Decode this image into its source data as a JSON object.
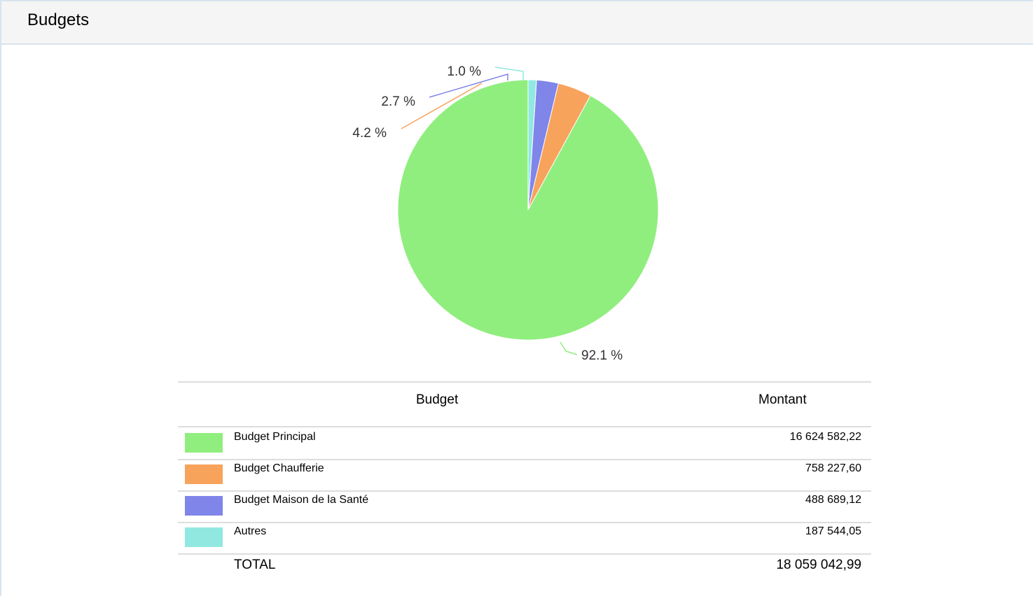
{
  "header": {
    "title": "Budgets"
  },
  "chart_data": {
    "type": "pie",
    "title": "",
    "slices": [
      {
        "label": "Budget Principal",
        "value": 16624582.22,
        "percent_label": "92.1 %",
        "color": "#90ee7e"
      },
      {
        "label": "Budget Chaufferie",
        "value": 758227.6,
        "percent_label": "4.2 %",
        "color": "#f7a35c"
      },
      {
        "label": "Budget Maison de la Santé",
        "value": 488689.12,
        "percent_label": "2.7 %",
        "color": "#8085e9"
      },
      {
        "label": "Autres",
        "value": 187544.05,
        "percent_label": "1.0 %",
        "color": "#91e8e1"
      }
    ]
  },
  "table": {
    "headers": {
      "budget": "Budget",
      "montant": "Montant"
    },
    "rows": [
      {
        "label": "Budget Principal",
        "amount": "16 624 582,22",
        "color": "#90ee7e"
      },
      {
        "label": "Budget Chaufferie",
        "amount": "758 227,60",
        "color": "#f7a35c"
      },
      {
        "label": "Budget Maison de la Santé",
        "amount": "488 689,12",
        "color": "#8085e9"
      },
      {
        "label": "Autres",
        "amount": "187 544,05",
        "color": "#91e8e1"
      }
    ],
    "total": {
      "label": "TOTAL",
      "amount": "18 059 042,99"
    }
  }
}
